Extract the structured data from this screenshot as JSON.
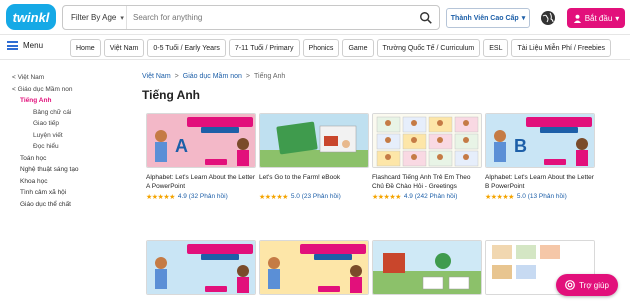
{
  "header": {
    "logo_text": "twinkl",
    "filter_label": "Filter By Age",
    "search_placeholder": "Search for anything",
    "member_label": "Thành Viên Cao Cấp",
    "start_label": "Bắt đầu"
  },
  "nav": {
    "menu_label": "Menu",
    "items": [
      "Home",
      "Việt Nam",
      "0-5 Tuổi / Early Years",
      "7-11 Tuổi / Primary",
      "Phonics",
      "Game",
      "Trường Quốc Tế / Curriculum",
      "ESL",
      "Tài Liệu Miễn Phí / Freebies"
    ]
  },
  "sidebar": {
    "items": [
      {
        "label": "< Việt Nam",
        "level": 0,
        "state": "normal"
      },
      {
        "label": "< Giáo dục Mầm non",
        "level": 0,
        "state": "normal"
      },
      {
        "label": "Tiếng Anh",
        "level": 1,
        "state": "active"
      },
      {
        "label": "Bảng chữ cái",
        "level": 2,
        "state": "normal"
      },
      {
        "label": "Giao tiếp",
        "level": 2,
        "state": "normal"
      },
      {
        "label": "Luyện viết",
        "level": 2,
        "state": "normal"
      },
      {
        "label": "Đọc hiểu",
        "level": 2,
        "state": "normal"
      },
      {
        "label": "Toán học",
        "level": 1,
        "state": "strong"
      },
      {
        "label": "Nghệ thuật sáng tạo",
        "level": 1,
        "state": "strong"
      },
      {
        "label": "Khoa học",
        "level": 1,
        "state": "strong"
      },
      {
        "label": "Tình cảm xã hội",
        "level": 1,
        "state": "strong"
      },
      {
        "label": "Giáo dục thể chất",
        "level": 1,
        "state": "strong"
      }
    ]
  },
  "breadcrumb": {
    "items": [
      "Việt Nam",
      "Giáo dục Mầm non",
      "Tiếng Anh"
    ],
    "separator": ">"
  },
  "page_title": "Tiếng Anh",
  "cards_row1": [
    {
      "title": "Alphabet: Let's Learn About the Letter A PowerPoint",
      "stars": "★★★★★",
      "score": "4.9 (32 Phản hồi)",
      "thumb_heading": "Let's Learn About",
      "thumb_sub": "the Letter A",
      "thumb_letter": "A",
      "badge": "PowerPoint",
      "bg": "#f3b8c8"
    },
    {
      "title": "Let's Go to the Farm! eBook",
      "stars": "★★★★★",
      "score": "5.0 (23 Phản hồi)",
      "thumb_heading": "Let's Go to the Farm!",
      "thumb_sub": "",
      "thumb_letter": "",
      "badge": "",
      "bg": "#bfe0f0"
    },
    {
      "title": "Flashcard Tiếng Anh Trẻ Em Theo Chủ Đề Chào Hỏi - Greetings Flashcard English",
      "stars": "★★★★★",
      "score": "4.9 (242 Phản hồi)",
      "thumb_heading": "",
      "thumb_sub": "",
      "thumb_letter": "",
      "badge": "",
      "bg": "#fff4c4"
    },
    {
      "title": "Alphabet: Let's Learn About the Letter B PowerPoint",
      "stars": "★★★★★",
      "score": "5.0 (13 Phản hồi)",
      "thumb_heading": "Let's Learn About",
      "thumb_sub": "the Letter B",
      "thumb_letter": "B",
      "badge": "PowerPoint",
      "bg": "#c9e5f5"
    }
  ],
  "cards_row2": [
    {
      "thumb_heading": "Let's Learn About",
      "thumb_sub": "the Letter C",
      "bg": "#c9e5f5"
    },
    {
      "thumb_heading": "Let's Learn About",
      "thumb_sub": "the Letter D",
      "bg": "#fde6a8"
    },
    {
      "thumb_heading": "",
      "thumb_sub": "",
      "bg": "#e8f4e6"
    },
    {
      "thumb_heading": "",
      "thumb_sub": "",
      "bg": "#fff"
    }
  ],
  "help": {
    "label": "Trợ giúp"
  }
}
